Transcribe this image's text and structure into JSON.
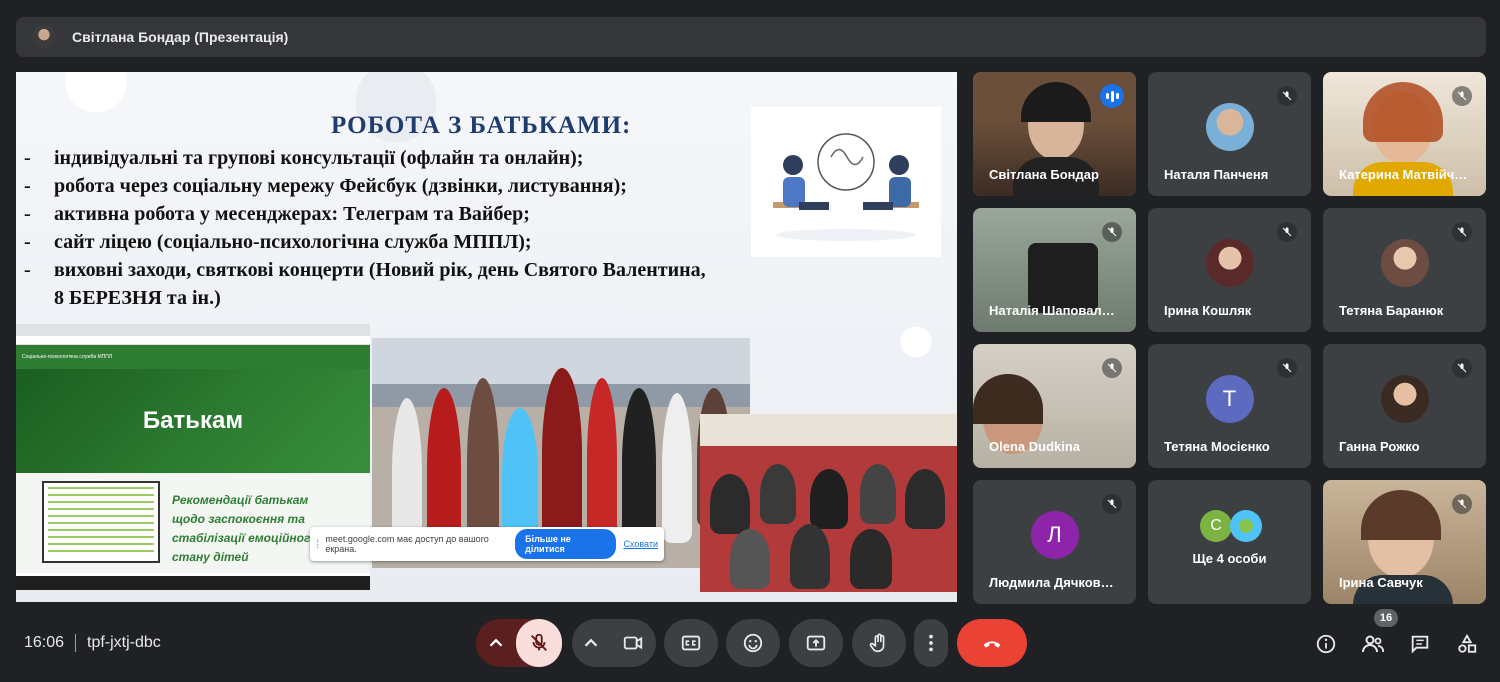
{
  "header": {
    "presenter_label": "Світлана Бондар (Презентація)"
  },
  "slide": {
    "title": "РОБОТА З БАТЬКАМИ:",
    "bullets": [
      "індивідуальні та групові консультації (офлайн та онлайн);",
      "робота через соціальну мережу Фейсбук (дзвінки, листування);",
      "активна робота у месенджерах: Телеграм та Вайбер;",
      "сайт ліцею (соціально-психологічна служба МППЛ);",
      "виховні заходи, святкові концерти (Новий рік, день Святого Валентина,"
    ],
    "bullet_continuation": "8 БЕРЕЗНЯ та ін.)",
    "site": {
      "nav_title": "Соціально-психологічна служба МППЛ",
      "hero": "Батькам",
      "recommendation": "Рекомендації батькам щодо заспокоєння та стабілізації емоційного стану дітей"
    }
  },
  "share_bar": {
    "message": "meet.google.com має доступ до вашого екрана.",
    "stop_label": "Більше не ділитися",
    "hide_label": "Сховати"
  },
  "participants": [
    {
      "name": "Світлана Бондар",
      "speaking": true
    },
    {
      "name": "Наталя Панченя",
      "muted": true
    },
    {
      "name": "Катерина Матвійч…",
      "muted": true
    },
    {
      "name": "Наталія Шаповал…",
      "muted": true
    },
    {
      "name": "Ірина Кошляк",
      "muted": true
    },
    {
      "name": "Тетяна Баранюк",
      "muted": true
    },
    {
      "name": "Olena Dudkina",
      "muted": true
    },
    {
      "name": "Тетяна Мосієнко",
      "initial": "Т",
      "color": "#5c6bc0",
      "muted": true
    },
    {
      "name": "Ганна Рожко",
      "muted": true
    },
    {
      "name": "Людмила Дячков…",
      "initial": "Л",
      "color": "#8e24aa",
      "muted": true
    },
    {
      "name": "Ще 4 особи",
      "initial": "С",
      "color": "#7cb342"
    },
    {
      "name": "Ірина Савчук",
      "muted": true
    }
  ],
  "bottom": {
    "time": "16:06",
    "meeting_code": "tpf-jxtj-dbc",
    "people_count": "16",
    "end_call_color": "#ea4335"
  }
}
